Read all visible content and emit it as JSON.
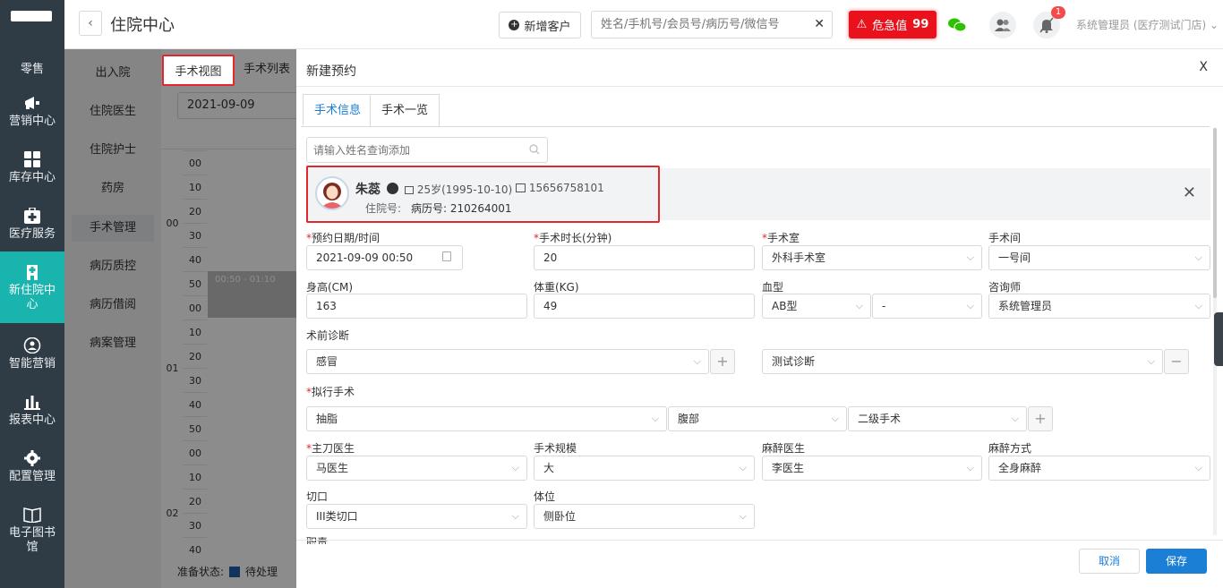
{
  "sidebar": {
    "items": [
      {
        "label": "零售",
        "icon": "retail-icon"
      },
      {
        "label": "营销中心",
        "icon": "megaphone-icon"
      },
      {
        "label": "库存中心",
        "icon": "grid-icon"
      },
      {
        "label": "医疗服务",
        "icon": "medical-kit-icon"
      },
      {
        "label": "新住院中心",
        "icon": "hospital-icon"
      },
      {
        "label": "智能营销",
        "icon": "smart-marketing-icon"
      },
      {
        "label": "报表中心",
        "icon": "bar-chart-icon"
      },
      {
        "label": "配置管理",
        "icon": "gear-icon"
      },
      {
        "label": "电子图书馆",
        "icon": "book-icon"
      }
    ],
    "active_color": "#18b4ad"
  },
  "header": {
    "title": "住院中心",
    "add_customer": "新增客户",
    "search_placeholder": "姓名/手机号/会员号/病历号/微信号",
    "danger_label": "危急值",
    "danger_count": "99",
    "notification_count": "1",
    "user": "系统管理员 (医疗测试门店)"
  },
  "submenu": {
    "items": [
      "出入院",
      "住院医生",
      "住院护士",
      "药房",
      "手术管理",
      "病历质控",
      "病历借阅",
      "病案管理"
    ]
  },
  "background": {
    "tabs": [
      "手术视图",
      "手术列表"
    ],
    "date": "2021-09-09",
    "hours": [
      "00",
      "01",
      "02"
    ],
    "minutes": [
      "00",
      "10",
      "20",
      "30",
      "40",
      "50",
      "00",
      "10",
      "20",
      "30",
      "40",
      "50",
      "00",
      "10",
      "20",
      "30",
      "40"
    ],
    "event": "00:50 - 01:10",
    "status_label": "准备状态:",
    "status_pending": "待处理"
  },
  "modal": {
    "title": "新建预约",
    "close": "X",
    "tabs": [
      "手术信息",
      "手术一览"
    ],
    "patient_search_placeholder": "请输入姓名查询添加",
    "patient": {
      "name": "朱蕊",
      "age": "25岁(1995-10-10)",
      "phone": "15656758101",
      "inpatient_label": "住院号:",
      "record": "病历号: 210264001"
    },
    "fields": {
      "appt_label": "预约日期/时间",
      "appt_value": "2021-09-09 00:50",
      "duration_label": "手术时长(分钟)",
      "duration_value": "20",
      "room_label": "手术室",
      "room_value": "外科手术室",
      "theatre_label": "手术间",
      "theatre_value": "一号间",
      "height_label": "身高(CM)",
      "height_value": "163",
      "weight_label": "体重(KG)",
      "weight_value": "49",
      "blood_label": "血型",
      "blood_value": "AB型",
      "rh_value": "-",
      "consultant_label": "咨询师",
      "consultant_value": "系统管理员",
      "prediag_label": "术前诊断",
      "prediag_value": "感冒",
      "prediag_value2": "测试诊断",
      "planned_label": "拟行手术",
      "planned_value": "抽脂",
      "site_value": "腹部",
      "grade_value": "二级手术",
      "surgeon_label": "主刀医生",
      "surgeon_value": "马医生",
      "scale_label": "手术规模",
      "scale_value": "大",
      "anesth_label": "麻醉医生",
      "anesth_value": "李医生",
      "anesth_method_label": "麻醉方式",
      "anesth_method_value": "全身麻醉",
      "incision_label": "切口",
      "incision_value": "III类切口",
      "position_label": "体位",
      "position_value": "侧卧位",
      "duty_label": "职责"
    },
    "cancel": "取消",
    "save": "保存"
  },
  "colors": {
    "primary": "#1c7fd6",
    "danger": "#e9111c",
    "highlight": "#e5262d",
    "sidebar_bg": "#2f3b45"
  }
}
